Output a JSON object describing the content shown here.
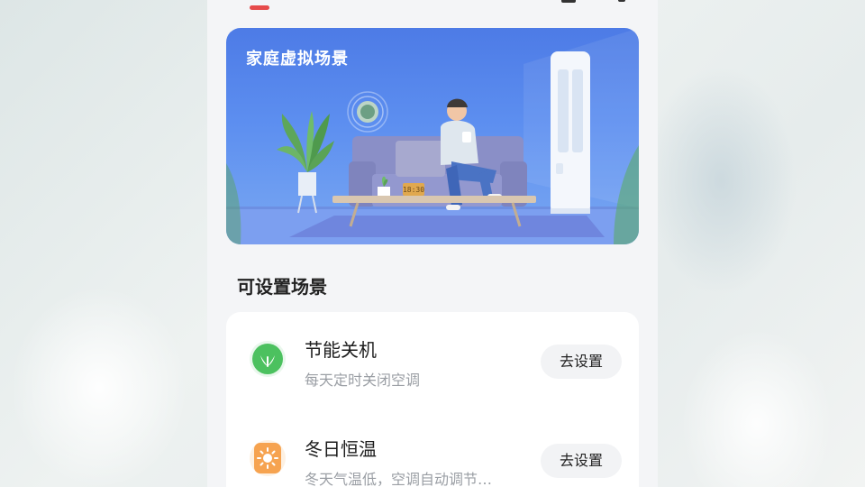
{
  "hero": {
    "title": "家庭虚拟场景",
    "clock_text": "18:30"
  },
  "section": {
    "title": "可设置场景"
  },
  "scenes": [
    {
      "name": "节能关机",
      "desc": "每天定时关闭空调",
      "button": "去设置",
      "icon": "leaf-icon",
      "color": "#4cc15f"
    },
    {
      "name": "冬日恒温",
      "desc": "冬天气温低，空调自动调节…",
      "button": "去设置",
      "icon": "sun-icon",
      "color": "#f6a350"
    }
  ]
}
